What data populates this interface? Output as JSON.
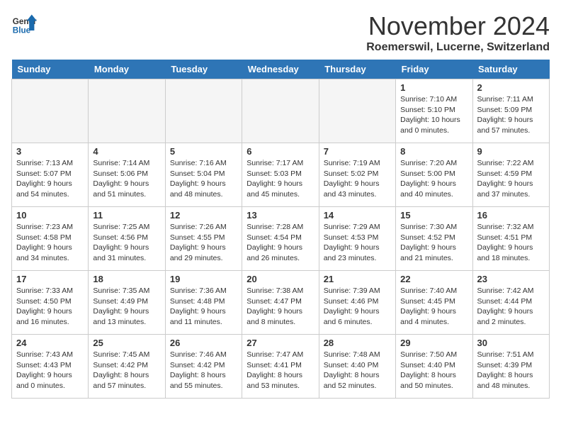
{
  "header": {
    "logo_general": "General",
    "logo_blue": "Blue",
    "month": "November 2024",
    "location": "Roemerswil, Lucerne, Switzerland"
  },
  "weekdays": [
    "Sunday",
    "Monday",
    "Tuesday",
    "Wednesday",
    "Thursday",
    "Friday",
    "Saturday"
  ],
  "weeks": [
    [
      {
        "day": "",
        "info": "",
        "empty": true
      },
      {
        "day": "",
        "info": "",
        "empty": true
      },
      {
        "day": "",
        "info": "",
        "empty": true
      },
      {
        "day": "",
        "info": "",
        "empty": true
      },
      {
        "day": "",
        "info": "",
        "empty": true
      },
      {
        "day": "1",
        "info": "Sunrise: 7:10 AM\nSunset: 5:10 PM\nDaylight: 10 hours\nand 0 minutes.",
        "empty": false
      },
      {
        "day": "2",
        "info": "Sunrise: 7:11 AM\nSunset: 5:09 PM\nDaylight: 9 hours\nand 57 minutes.",
        "empty": false
      }
    ],
    [
      {
        "day": "3",
        "info": "Sunrise: 7:13 AM\nSunset: 5:07 PM\nDaylight: 9 hours\nand 54 minutes.",
        "empty": false
      },
      {
        "day": "4",
        "info": "Sunrise: 7:14 AM\nSunset: 5:06 PM\nDaylight: 9 hours\nand 51 minutes.",
        "empty": false
      },
      {
        "day": "5",
        "info": "Sunrise: 7:16 AM\nSunset: 5:04 PM\nDaylight: 9 hours\nand 48 minutes.",
        "empty": false
      },
      {
        "day": "6",
        "info": "Sunrise: 7:17 AM\nSunset: 5:03 PM\nDaylight: 9 hours\nand 45 minutes.",
        "empty": false
      },
      {
        "day": "7",
        "info": "Sunrise: 7:19 AM\nSunset: 5:02 PM\nDaylight: 9 hours\nand 43 minutes.",
        "empty": false
      },
      {
        "day": "8",
        "info": "Sunrise: 7:20 AM\nSunset: 5:00 PM\nDaylight: 9 hours\nand 40 minutes.",
        "empty": false
      },
      {
        "day": "9",
        "info": "Sunrise: 7:22 AM\nSunset: 4:59 PM\nDaylight: 9 hours\nand 37 minutes.",
        "empty": false
      }
    ],
    [
      {
        "day": "10",
        "info": "Sunrise: 7:23 AM\nSunset: 4:58 PM\nDaylight: 9 hours\nand 34 minutes.",
        "empty": false
      },
      {
        "day": "11",
        "info": "Sunrise: 7:25 AM\nSunset: 4:56 PM\nDaylight: 9 hours\nand 31 minutes.",
        "empty": false
      },
      {
        "day": "12",
        "info": "Sunrise: 7:26 AM\nSunset: 4:55 PM\nDaylight: 9 hours\nand 29 minutes.",
        "empty": false
      },
      {
        "day": "13",
        "info": "Sunrise: 7:28 AM\nSunset: 4:54 PM\nDaylight: 9 hours\nand 26 minutes.",
        "empty": false
      },
      {
        "day": "14",
        "info": "Sunrise: 7:29 AM\nSunset: 4:53 PM\nDaylight: 9 hours\nand 23 minutes.",
        "empty": false
      },
      {
        "day": "15",
        "info": "Sunrise: 7:30 AM\nSunset: 4:52 PM\nDaylight: 9 hours\nand 21 minutes.",
        "empty": false
      },
      {
        "day": "16",
        "info": "Sunrise: 7:32 AM\nSunset: 4:51 PM\nDaylight: 9 hours\nand 18 minutes.",
        "empty": false
      }
    ],
    [
      {
        "day": "17",
        "info": "Sunrise: 7:33 AM\nSunset: 4:50 PM\nDaylight: 9 hours\nand 16 minutes.",
        "empty": false
      },
      {
        "day": "18",
        "info": "Sunrise: 7:35 AM\nSunset: 4:49 PM\nDaylight: 9 hours\nand 13 minutes.",
        "empty": false
      },
      {
        "day": "19",
        "info": "Sunrise: 7:36 AM\nSunset: 4:48 PM\nDaylight: 9 hours\nand 11 minutes.",
        "empty": false
      },
      {
        "day": "20",
        "info": "Sunrise: 7:38 AM\nSunset: 4:47 PM\nDaylight: 9 hours\nand 8 minutes.",
        "empty": false
      },
      {
        "day": "21",
        "info": "Sunrise: 7:39 AM\nSunset: 4:46 PM\nDaylight: 9 hours\nand 6 minutes.",
        "empty": false
      },
      {
        "day": "22",
        "info": "Sunrise: 7:40 AM\nSunset: 4:45 PM\nDaylight: 9 hours\nand 4 minutes.",
        "empty": false
      },
      {
        "day": "23",
        "info": "Sunrise: 7:42 AM\nSunset: 4:44 PM\nDaylight: 9 hours\nand 2 minutes.",
        "empty": false
      }
    ],
    [
      {
        "day": "24",
        "info": "Sunrise: 7:43 AM\nSunset: 4:43 PM\nDaylight: 9 hours\nand 0 minutes.",
        "empty": false
      },
      {
        "day": "25",
        "info": "Sunrise: 7:45 AM\nSunset: 4:42 PM\nDaylight: 8 hours\nand 57 minutes.",
        "empty": false
      },
      {
        "day": "26",
        "info": "Sunrise: 7:46 AM\nSunset: 4:42 PM\nDaylight: 8 hours\nand 55 minutes.",
        "empty": false
      },
      {
        "day": "27",
        "info": "Sunrise: 7:47 AM\nSunset: 4:41 PM\nDaylight: 8 hours\nand 53 minutes.",
        "empty": false
      },
      {
        "day": "28",
        "info": "Sunrise: 7:48 AM\nSunset: 4:40 PM\nDaylight: 8 hours\nand 52 minutes.",
        "empty": false
      },
      {
        "day": "29",
        "info": "Sunrise: 7:50 AM\nSunset: 4:40 PM\nDaylight: 8 hours\nand 50 minutes.",
        "empty": false
      },
      {
        "day": "30",
        "info": "Sunrise: 7:51 AM\nSunset: 4:39 PM\nDaylight: 8 hours\nand 48 minutes.",
        "empty": false
      }
    ]
  ]
}
